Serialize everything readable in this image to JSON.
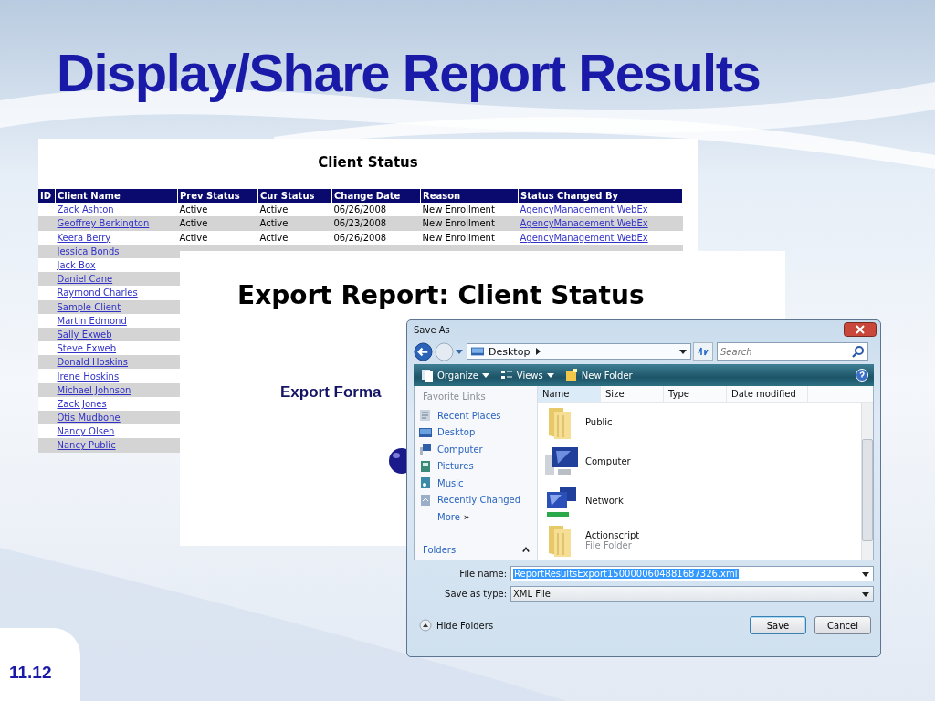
{
  "slide": {
    "title": "Display/Share Report Results",
    "number": "11.12"
  },
  "report": {
    "title": "Client Status",
    "columns": [
      "ID",
      "Client Name",
      "Prev Status",
      "Cur Status",
      "Change Date",
      "Reason",
      "Status Changed By"
    ],
    "rows": [
      {
        "client_name": "Zack Ashton",
        "prev_status": "Active",
        "cur_status": "Active",
        "change_date": "06/26/2008",
        "reason": "New Enrollment",
        "changed_by": "AgencyManagement WebEx"
      },
      {
        "client_name": "Geoffrey Berkington",
        "prev_status": "Active",
        "cur_status": "Active",
        "change_date": "06/23/2008",
        "reason": "New Enrollment",
        "changed_by": "AgencyManagement WebEx"
      },
      {
        "client_name": "Keera Berry",
        "prev_status": "Active",
        "cur_status": "Active",
        "change_date": "06/26/2008",
        "reason": "New Enrollment",
        "changed_by": "AgencyManagement WebEx"
      },
      {
        "client_name": "Jessica Bonds"
      },
      {
        "client_name": "Jack Box"
      },
      {
        "client_name": "Daniel Cane"
      },
      {
        "client_name": "Raymond Charles"
      },
      {
        "client_name": "Sample Client"
      },
      {
        "client_name": "Martin Edmond"
      },
      {
        "client_name": "Sally Exweb"
      },
      {
        "client_name": "Steve Exweb"
      },
      {
        "client_name": "Donald Hoskins"
      },
      {
        "client_name": "Irene Hoskins"
      },
      {
        "client_name": "Michael Johnson"
      },
      {
        "client_name": "Zack Jones"
      },
      {
        "client_name": "Otis Mudbone"
      },
      {
        "client_name": "Nancy Olsen"
      },
      {
        "client_name": "Nancy Public"
      }
    ]
  },
  "export_page": {
    "heading": "Export Report: Client Status",
    "subheading": "Export Forma"
  },
  "save_dialog": {
    "title": "Save As",
    "address": "Desktop",
    "search": {
      "placeholder": "Search"
    },
    "toolbar": [
      {
        "label": "Organize",
        "kind": "organize",
        "menu": true
      },
      {
        "label": "Views",
        "kind": "views",
        "menu": true
      },
      {
        "label": "New Folder",
        "kind": "new-folder",
        "menu": false
      }
    ],
    "favorite_links": {
      "heading": "Favorite Links",
      "items": [
        {
          "label": "Recent Places",
          "kind": "recent"
        },
        {
          "label": "Desktop",
          "kind": "desktop"
        },
        {
          "label": "Computer",
          "kind": "computer"
        },
        {
          "label": "Pictures",
          "kind": "pictures"
        },
        {
          "label": "Music",
          "kind": "music"
        },
        {
          "label": "Recently Changed",
          "kind": "changed"
        }
      ],
      "more": "More",
      "more_glyph": "»"
    },
    "folders": {
      "label": "Folders",
      "expanded": true
    },
    "file_list": {
      "columns": [
        "Name",
        "Size",
        "Type",
        "Date modified"
      ],
      "items": [
        {
          "name": "Public",
          "kind": "folder"
        },
        {
          "name": "Computer",
          "kind": "computer"
        },
        {
          "name": "Network",
          "kind": "network"
        },
        {
          "name": "Actionscript",
          "detail": "File Folder",
          "kind": "folder"
        }
      ]
    },
    "file_name": {
      "label": "File name:",
      "value": "ReportResultsExport1500000604881687326.xml"
    },
    "save_type": {
      "label": "Save as type:",
      "value": "XML File"
    },
    "hide_folders": "Hide Folders",
    "buttons": [
      {
        "label": "Save",
        "default": true
      },
      {
        "label": "Cancel",
        "default": false
      }
    ]
  }
}
